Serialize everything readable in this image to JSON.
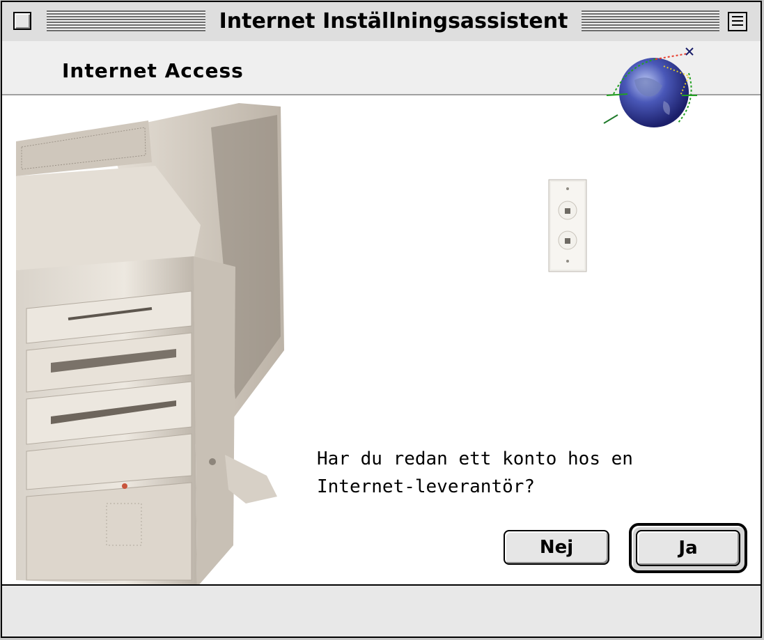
{
  "window": {
    "title": "Internet Inställningsassistent"
  },
  "header": {
    "title": "Internet Access"
  },
  "main": {
    "question_line1": "Har du redan ett konto hos en",
    "question_line2": "Internet-leverantör?"
  },
  "buttons": {
    "no_label": "Nej",
    "yes_label": "Ja"
  },
  "icons": {
    "globe": "globe-icon",
    "phone_jack": "phone-jack-icon",
    "computer": "power-mac-computer-illustration"
  }
}
